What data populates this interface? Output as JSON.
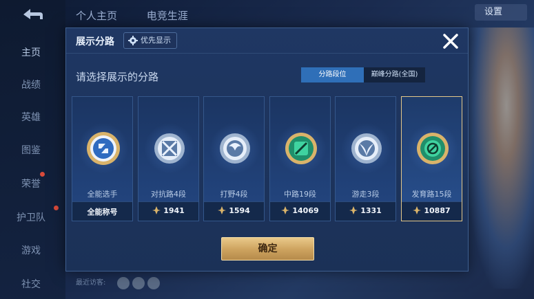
{
  "background": {
    "tabs": [
      "个人主页",
      "电竞生涯"
    ],
    "settings_label": "设置",
    "nav": [
      "主页",
      "战绩",
      "英雄",
      "图鉴",
      "荣誉",
      "护卫队",
      "游戏",
      "社交"
    ],
    "recent_visitors": "最近访客:"
  },
  "modal": {
    "title": "展示分路",
    "priority_label": "优先显示",
    "subtitle": "请选择展示的分路",
    "toggle": [
      "分路段位",
      "巅峰分路(全国)"
    ],
    "confirm_label": "确定"
  },
  "cards": [
    {
      "name": "全能选手",
      "score": "全能称号",
      "has_icon": false
    },
    {
      "name": "对抗路4段",
      "score": "1941",
      "has_icon": true
    },
    {
      "name": "打野4段",
      "score": "1594",
      "has_icon": true
    },
    {
      "name": "中路19段",
      "score": "14069",
      "has_icon": true
    },
    {
      "name": "游走3段",
      "score": "1331",
      "has_icon": true
    },
    {
      "name": "发育路15段",
      "score": "10887",
      "has_icon": true
    }
  ],
  "colors": {
    "selected_border": "#e6c98a",
    "toggle_active": "#2f6fb8",
    "confirm_gold": "#cfa561"
  }
}
